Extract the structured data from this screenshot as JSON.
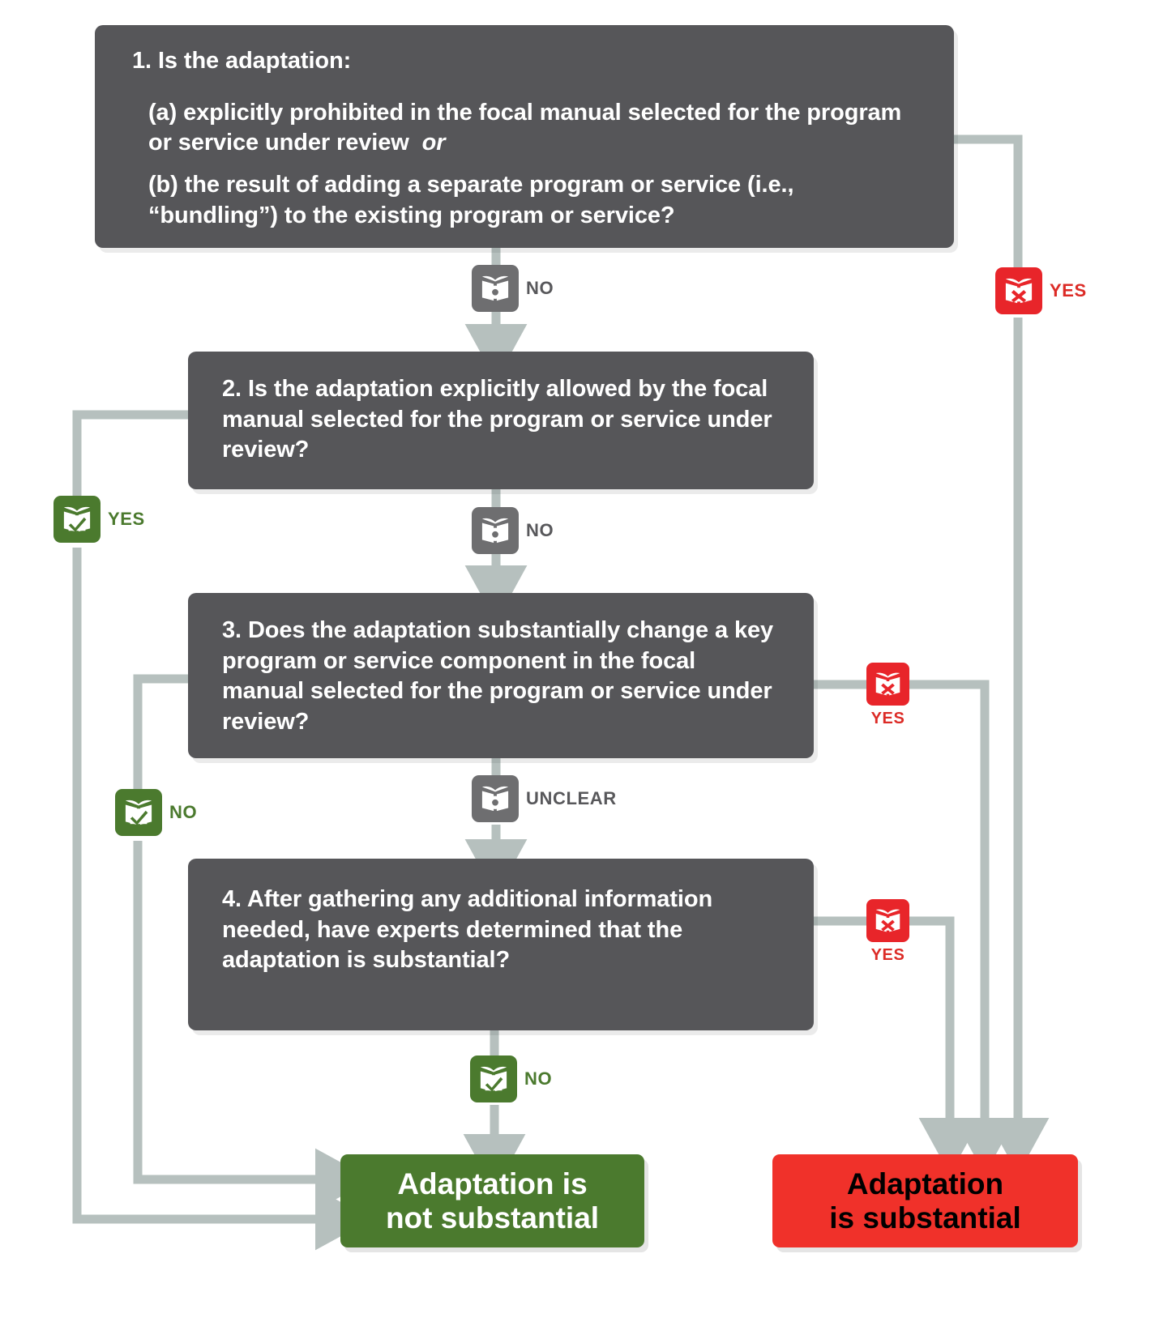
{
  "diagram": {
    "title": "Substantial adaptation decision flowchart",
    "colors": {
      "question_box": "#565659",
      "connector": "#B6C0BE",
      "green": "#4B7A2E",
      "red": "#F0312A",
      "chip_gray": "#6E6E70",
      "chip_red": "#E8252A"
    }
  },
  "questions": [
    {
      "id": "q1",
      "number": "1.",
      "heading": "1. Is the adaptation:",
      "option_a": "(a) explicitly prohibited in the focal manual selected for the program or service under review",
      "option_a_conjunction": "or",
      "option_b": "(b) the result of adding a separate program or service (i.e., “bundling”) to the existing program or service?"
    },
    {
      "id": "q2",
      "text": "2. Is the adaptation explicitly allowed by the focal manual selected for the program or service under review?"
    },
    {
      "id": "q3",
      "text": "3. Does the adaptation substantially change a key program or service component in the focal manual selected for the program or service under review?"
    },
    {
      "id": "q4",
      "text": "4. After gathering any additional information needed, have experts determined that the adaptation is substantial?"
    }
  ],
  "badges": [
    {
      "id": "b1-no",
      "label": "NO",
      "icon": "book-circle-icon",
      "color": "gray"
    },
    {
      "id": "b1-yes",
      "label": "YES",
      "icon": "book-x-icon",
      "color": "red"
    },
    {
      "id": "b2-yes",
      "label": "YES",
      "icon": "book-check-icon",
      "color": "green"
    },
    {
      "id": "b2-no",
      "label": "NO",
      "icon": "book-circle-icon",
      "color": "gray"
    },
    {
      "id": "b3-yes",
      "label": "YES",
      "icon": "book-x-icon",
      "color": "red"
    },
    {
      "id": "b3-no",
      "label": "NO",
      "icon": "book-check-icon",
      "color": "green"
    },
    {
      "id": "b3-unclear",
      "label": "UNCLEAR",
      "icon": "book-circle-icon",
      "color": "gray"
    },
    {
      "id": "b4-yes",
      "label": "YES",
      "icon": "book-x-icon",
      "color": "red"
    },
    {
      "id": "b4-no",
      "label": "NO",
      "icon": "book-check-icon",
      "color": "green"
    }
  ],
  "outcomes": {
    "not_substantial": {
      "line1": "Adaptation is",
      "line2": "not substantial"
    },
    "substantial": {
      "line1": "Adaptation",
      "line2": "is substantial"
    }
  }
}
